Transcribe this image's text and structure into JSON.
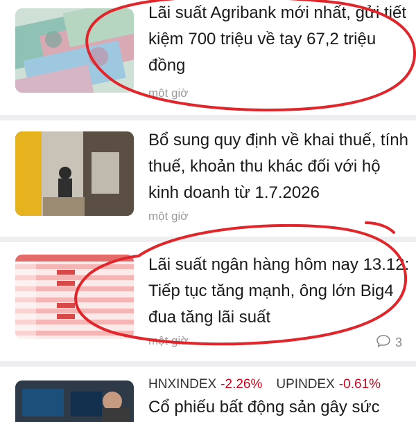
{
  "articles": [
    {
      "title": "Lãi suất Agribank mới nhất, gửi tiết kiệm 700 triệu về tay 67,2 triệu đồng",
      "time": "một giờ",
      "thumb_icon": "cash-banknotes-image"
    },
    {
      "title": "Bổ sung quy định về khai thuế, tính thuế, khoản thu khác đối với hộ kinh doanh từ 1.7.2026",
      "time": "một giờ",
      "thumb_icon": "street-vendor-shop-image"
    },
    {
      "title": "Lãi suất ngân hàng hôm nay 13.12: Tiếp tục tăng mạnh, ông lớn Big4 đua tăng lãi suất",
      "time": "một giờ",
      "comments": "3",
      "thumb_icon": "interest-rate-table-image"
    },
    {
      "title": "Cổ phiếu bất động sản gây sức",
      "thumb_icon": "stock-trader-screens-image"
    }
  ],
  "tickers": [
    {
      "name": "HNXINDEX",
      "change": "-2.26%"
    },
    {
      "name": "UPINDEX",
      "change": "-0.61%"
    }
  ],
  "colors": {
    "negative": "#d0021b",
    "annotation": "#e0262b",
    "separator": "#eeeef0"
  }
}
